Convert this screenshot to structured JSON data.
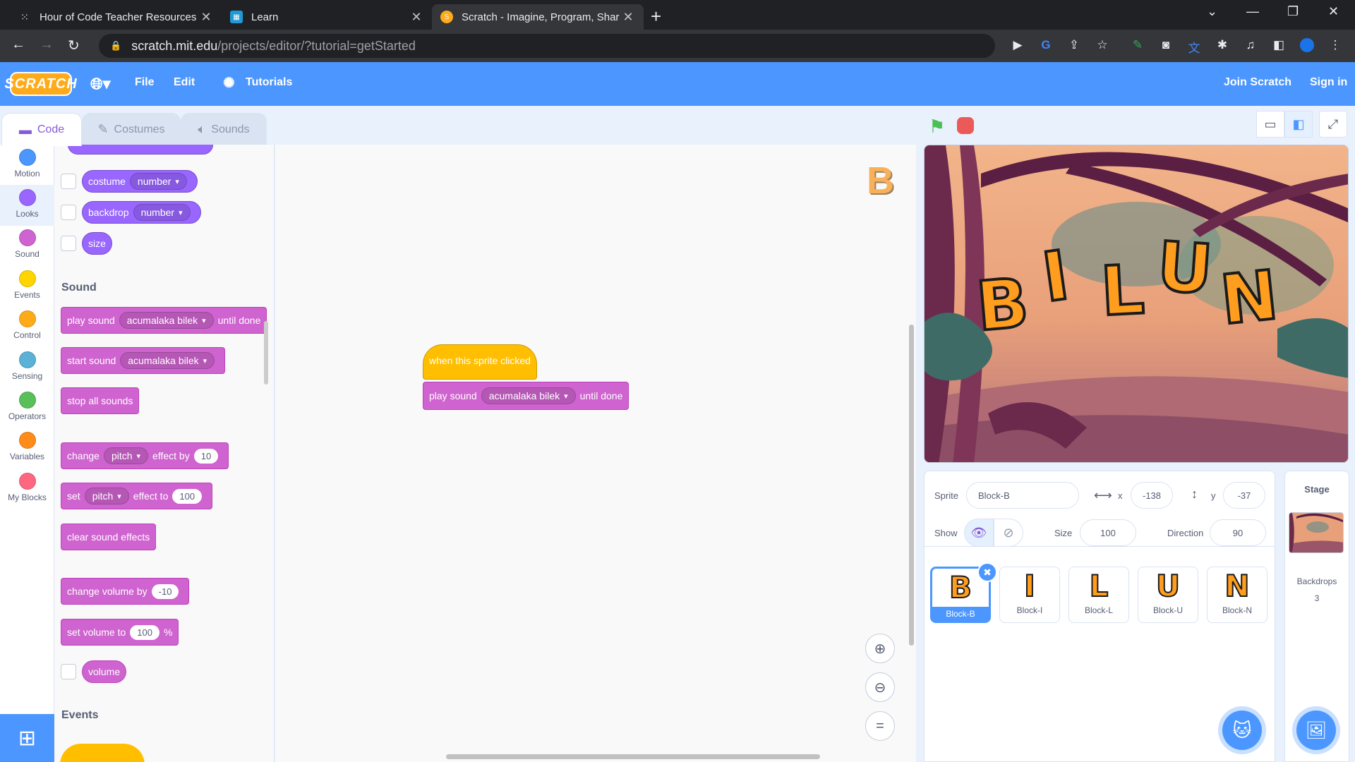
{
  "browser": {
    "tabs": [
      {
        "title": "Hour of Code Teacher Resources"
      },
      {
        "title": "Learn"
      },
      {
        "title": "Scratch - Imagine, Program, Shar"
      }
    ],
    "url_host": "scratch.mit.edu",
    "url_path": "/projects/editor/?tutorial=getStarted"
  },
  "menubar": {
    "logo": "SCRATCH",
    "file": "File",
    "edit": "Edit",
    "tutorials": "Tutorials",
    "join": "Join Scratch",
    "signin": "Sign in"
  },
  "editor_tabs": {
    "code": "Code",
    "costumes": "Costumes",
    "sounds": "Sounds"
  },
  "categories": [
    {
      "label": "Motion",
      "color": "#4c97ff"
    },
    {
      "label": "Looks",
      "color": "#9966ff"
    },
    {
      "label": "Sound",
      "color": "#cf63cf"
    },
    {
      "label": "Events",
      "color": "#ffd500"
    },
    {
      "label": "Control",
      "color": "#ffab19"
    },
    {
      "label": "Sensing",
      "color": "#5cb1d6"
    },
    {
      "label": "Operators",
      "color": "#59c059"
    },
    {
      "label": "Variables",
      "color": "#ff8c1a"
    },
    {
      "label": "My Blocks",
      "color": "#ff6680"
    }
  ],
  "palette": {
    "looks": {
      "costume": "costume",
      "costume_opt": "number",
      "backdrop": "backdrop",
      "backdrop_opt": "number",
      "size": "size"
    },
    "sound_heading": "Sound",
    "play_sound": {
      "a": "play sound",
      "opt": "acumalaka bilek",
      "b": "until done"
    },
    "start_sound": {
      "a": "start sound",
      "opt": "acumalaka bilek"
    },
    "stop_all": "stop all sounds",
    "change_effect": {
      "a": "change",
      "opt": "pitch",
      "b": "effect by",
      "val": "10"
    },
    "set_effect": {
      "a": "set",
      "opt": "pitch",
      "b": "effect to",
      "val": "100"
    },
    "clear_effects": "clear sound effects",
    "change_volume": {
      "a": "change volume by",
      "val": "-10"
    },
    "set_volume": {
      "a": "set volume to",
      "val": "100",
      "b": "%"
    },
    "volume": "volume",
    "events_heading": "Events"
  },
  "workspace": {
    "hat": "when this sprite clicked",
    "play": {
      "a": "play sound",
      "opt": "acumalaka bilek",
      "b": "until done"
    },
    "sprite_letter": "B"
  },
  "stage": {
    "letters": [
      "B",
      "I",
      "L",
      "U",
      "N"
    ]
  },
  "sprite_info": {
    "sprite_label": "Sprite",
    "sprite_name": "Block-B",
    "x_label": "x",
    "x": "-138",
    "y_label": "y",
    "y": "-37",
    "show_label": "Show",
    "size_label": "Size",
    "size": "100",
    "direction_label": "Direction",
    "direction": "90"
  },
  "sprites": [
    {
      "glyph": "B",
      "name": "Block-B"
    },
    {
      "glyph": "I",
      "name": "Block-I"
    },
    {
      "glyph": "L",
      "name": "Block-L"
    },
    {
      "glyph": "U",
      "name": "Block-U"
    },
    {
      "glyph": "N",
      "name": "Block-N"
    }
  ],
  "stage_pane": {
    "title": "Stage",
    "backdrops_label": "Backdrops",
    "backdrops_count": "3"
  }
}
